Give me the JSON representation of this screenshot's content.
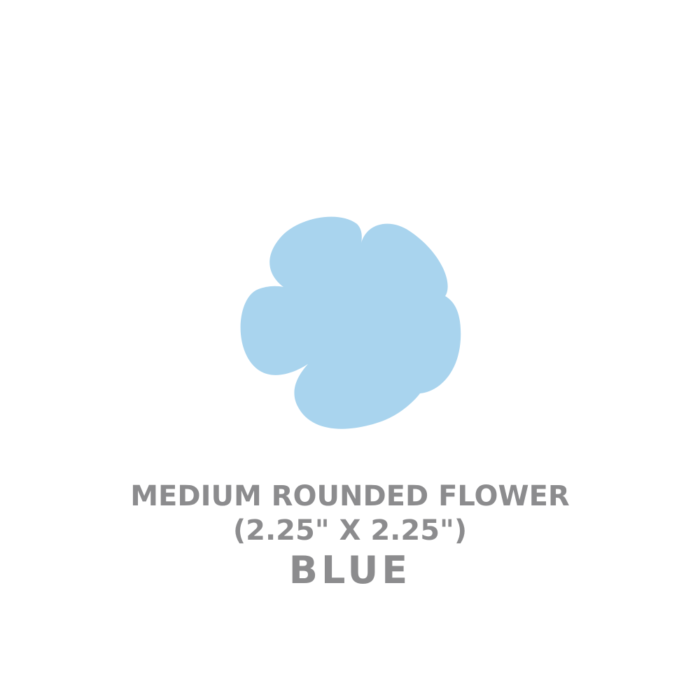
{
  "product": {
    "shape_name": "MEDIUM ROUNDED FLOWER",
    "size": "(2.25\" X 2.25\")",
    "color_name": "BLUE"
  },
  "shape": {
    "icon": "rounded-flower-icon",
    "fill": "#a9d4ee"
  },
  "caption_color": "#8c8c8e",
  "background": "#ffffff"
}
